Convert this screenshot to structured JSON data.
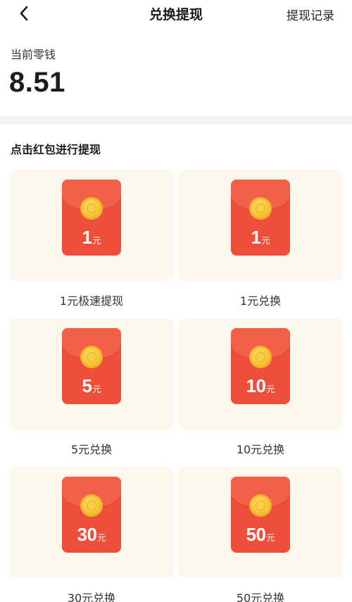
{
  "nav": {
    "back_icon": "chevron-left-icon",
    "title": "兑换提现",
    "right_link": "提现记录"
  },
  "balance": {
    "label": "当前零钱",
    "value": "8.51"
  },
  "section": {
    "title": "点击红包进行提现"
  },
  "colors": {
    "envelope": "#ef4e3a",
    "envelope_flap": "#f2604a",
    "coin": "#f7c437",
    "card_bg": "#fdf7ee",
    "divider": "#f3f3f3"
  },
  "options": [
    {
      "amount": "1",
      "unit": "元",
      "label": "1元极速提现"
    },
    {
      "amount": "1",
      "unit": "元",
      "label": "1元兑换"
    },
    {
      "amount": "5",
      "unit": "元",
      "label": "5元兑换"
    },
    {
      "amount": "10",
      "unit": "元",
      "label": "10元兑换"
    },
    {
      "amount": "30",
      "unit": "元",
      "label": "30元兑换"
    },
    {
      "amount": "50",
      "unit": "元",
      "label": "50元兑换"
    }
  ]
}
